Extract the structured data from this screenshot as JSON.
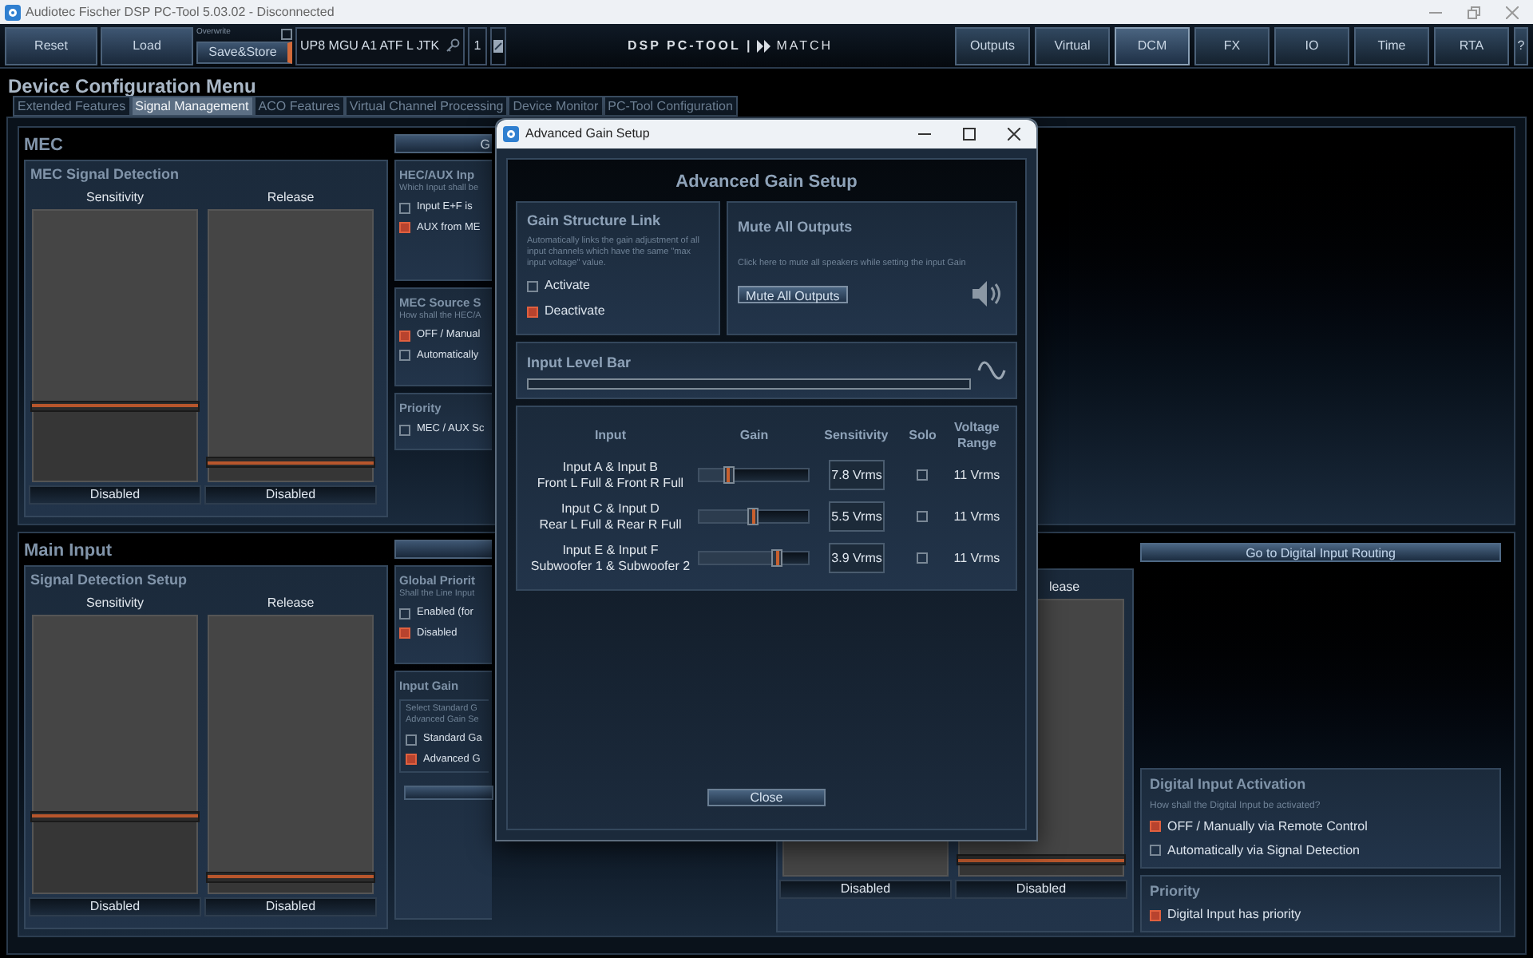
{
  "window": {
    "title": "Audiotec Fischer DSP PC-Tool 5.03.02 - Disconnected"
  },
  "toolbar": {
    "reset": "Reset",
    "load": "Load",
    "overwrite": {
      "label": "Overwrite",
      "checked": false
    },
    "save_store": "Save&Store",
    "device": "UP8 MGU A1 ATF L JTK",
    "device_number": "1",
    "logo": {
      "text": "DSP PC-TOOL |",
      "brand": "MATCH"
    },
    "nav": [
      {
        "label": "Outputs",
        "selected": false
      },
      {
        "label": "Virtual",
        "selected": false
      },
      {
        "label": "DCM",
        "selected": true
      },
      {
        "label": "FX",
        "selected": false
      },
      {
        "label": "IO",
        "selected": false
      },
      {
        "label": "Time",
        "selected": false
      },
      {
        "label": "RTA",
        "selected": false
      },
      {
        "label": "?",
        "selected": false
      }
    ]
  },
  "page": {
    "title": "Device Configuration Menu",
    "tabs": [
      {
        "label": "Extended Features",
        "selected": false
      },
      {
        "label": "Signal Management",
        "selected": true
      },
      {
        "label": "ACO Features",
        "selected": false
      },
      {
        "label": "Virtual Channel Processing",
        "selected": false
      },
      {
        "label": "Device Monitor",
        "selected": false
      },
      {
        "label": "PC-Tool Configuration",
        "selected": false
      }
    ]
  },
  "mec": {
    "title": "MEC",
    "signal_detection": {
      "title": "MEC Signal Detection",
      "sliders": [
        {
          "label": "Sensitivity",
          "level": 0.27,
          "status": "Disabled"
        },
        {
          "label": "Release",
          "level": 0.06,
          "status": "Disabled"
        }
      ]
    },
    "top_button": {
      "label": "G"
    },
    "panels": [
      {
        "title": "HEC/AUX Inp",
        "description": "Which Input shall be",
        "options": [
          {
            "label": "Input E+F is",
            "checked": false
          },
          {
            "label": "AUX from ME",
            "checked": true
          }
        ]
      },
      {
        "title": "MEC Source S",
        "description": "How shall the HEC/A",
        "options": [
          {
            "label": "OFF / Manual",
            "checked": true
          },
          {
            "label": "Automatically",
            "checked": false
          }
        ]
      },
      {
        "title": "Priority",
        "options": [
          {
            "label": "MEC / AUX Sc",
            "checked": false
          }
        ]
      }
    ]
  },
  "main_input": {
    "title": "Main Input",
    "signal_detection": {
      "title": "Signal Detection Setup",
      "sliders": [
        {
          "label": "Sensitivity",
          "level": 0.27,
          "status": "Disabled"
        },
        {
          "label": "Release",
          "level": 0.05,
          "status": "Disabled"
        }
      ]
    },
    "top_button": true,
    "panels": [
      {
        "title": "Global Priorit",
        "description": "Shall the Line Input",
        "options": [
          {
            "label": "Enabled (for",
            "checked": false
          },
          {
            "label": "Disabled",
            "checked": true
          }
        ]
      },
      {
        "title": "Input Gain",
        "description": "Select Standard G\nAdvanced Gain Se",
        "options": [
          {
            "label": "Standard Ga",
            "checked": false
          },
          {
            "label": "Advanced G",
            "checked": true
          }
        ],
        "button": true
      }
    ],
    "digital_detection": {
      "sliders": [
        {
          "status": "Disabled"
        },
        {
          "label": "lease",
          "level": 0.05,
          "status": "Disabled"
        }
      ]
    },
    "routing_button": "Go to Digital Input Routing",
    "digital_panels": [
      {
        "title": "Digital Input Activation",
        "description": "How shall the Digital Input be activated?",
        "options": [
          {
            "label": "OFF / Manually via Remote Control",
            "checked": true
          },
          {
            "label": "Automatically via Signal Detection",
            "checked": false
          }
        ]
      },
      {
        "title": "Priority",
        "options": [
          {
            "label": "Digital Input has priority",
            "checked": true
          }
        ]
      }
    ]
  },
  "dialog": {
    "title": "Advanced Gain Setup",
    "heading": "Advanced Gain Setup",
    "gain_link": {
      "title": "Gain Structure Link",
      "description": "Automatically links the gain adjustment of all input channels which have the same \"max input voltage\" value.",
      "options": [
        {
          "label": "Activate",
          "checked": false
        },
        {
          "label": "Deactivate",
          "checked": true
        }
      ]
    },
    "mute": {
      "title": "Mute All Outputs",
      "description": "Click here to mute all speakers while setting the input Gain",
      "button": "Mute All Outputs"
    },
    "level_bar": {
      "title": "Input Level Bar",
      "level": 0
    },
    "columns": [
      "Input",
      "Gain",
      "Sensitivity",
      "Solo",
      "Voltage Range"
    ],
    "rows": [
      {
        "input": "Input A & Input B",
        "channels": "Front L Full & Front R Full",
        "level": 0.27,
        "sensitivity": "7.8 Vrms",
        "solo": false,
        "range": "11 Vrms"
      },
      {
        "input": "Input C & Input D",
        "channels": "Rear L Full & Rear R Full",
        "level": 0.5,
        "sensitivity": "5.5 Vrms",
        "solo": false,
        "range": "11 Vrms"
      },
      {
        "input": "Input E & Input F",
        "channels": "Subwoofer 1 & Subwoofer 2",
        "level": 0.72,
        "sensitivity": "3.9 Vrms",
        "solo": false,
        "range": "11 Vrms"
      }
    ],
    "close": "Close"
  }
}
